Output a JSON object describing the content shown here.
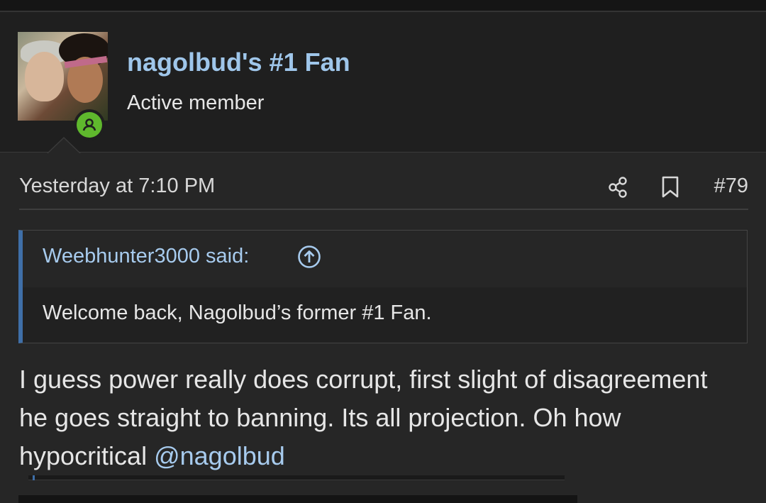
{
  "post": {
    "username": "nagolbud's #1 Fan",
    "user_title": "Active member",
    "date": "Yesterday at 7:10 PM",
    "post_number": "#79",
    "icons": {
      "share": "share-icon",
      "bookmark": "bookmark-icon",
      "status": "online-user-icon",
      "quote_jump": "arrow-up-circle-icon"
    },
    "quote": {
      "author_label": "Weebhunter3000 said:",
      "text": "Welcome back, Nagolbud’s former #1 Fan."
    },
    "body_text": "I guess power really does corrupt, first slight of disagreement he goes straight to banning. Its all projection. Oh how hypocritical ",
    "mention": "@nagolbud"
  },
  "colors": {
    "background": "#262626",
    "header_background": "#1f1f1f",
    "username": "#9fc6ea",
    "link": "#a7cbee",
    "quote_bar": "#3f6fa8",
    "status_online": "#5fb82d"
  }
}
